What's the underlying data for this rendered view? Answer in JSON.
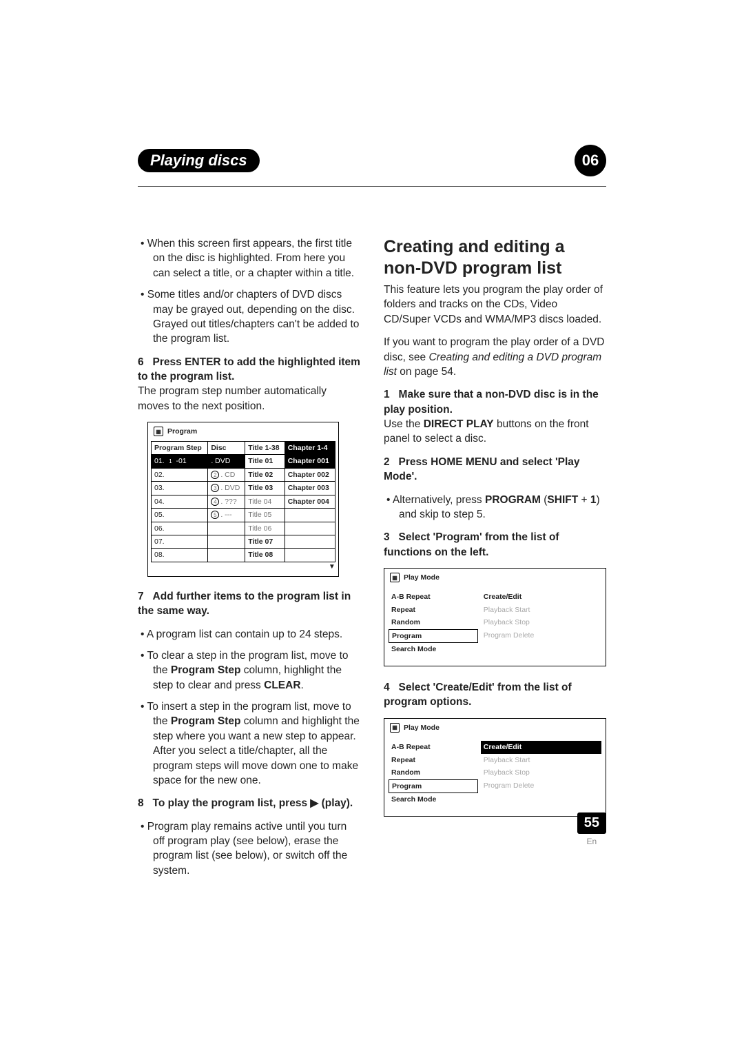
{
  "header": {
    "chapter_label": "Playing discs",
    "chapter_num": "06"
  },
  "left": {
    "intro_bullets": [
      "When this screen first appears, the first title on the disc is highlighted. From here you can select a title, or a chapter within a title.",
      "Some titles and/or chapters of DVD discs may be grayed out, depending on the disc. Grayed out titles/chapters can't be added to the program list."
    ],
    "step6_num": "6",
    "step6_head": "Press ENTER to add the highlighted item to the program list.",
    "step6_body": "The program step number automatically moves to the next position.",
    "prog_title": "Program",
    "prog_headers": {
      "step": "Program Step",
      "disc": "Disc",
      "title": "Title 1-38",
      "chapter": "Chapter 1-4"
    },
    "prog_rows": [
      {
        "step": "01.",
        "disc_num": "1",
        "disc_suffix": "-01",
        "disc": ". DVD",
        "title": "Title 01",
        "chapter": "Chapter 001",
        "sel": true,
        "bold_title": true,
        "bold_chap": true
      },
      {
        "step": "02.",
        "disc_num": "2",
        "disc": ". CD",
        "title": "Title 02",
        "chapter": "Chapter 002",
        "gray_disc": true,
        "bold_title": true,
        "bold_chap": true
      },
      {
        "step": "03.",
        "disc_num": "3",
        "disc": ". DVD",
        "title": "Title 03",
        "chapter": "Chapter 003",
        "gray_disc": true,
        "bold_title": true,
        "bold_chap": true
      },
      {
        "step": "04.",
        "disc_num": "4",
        "disc": ". ???",
        "title": "Title 04",
        "chapter": "Chapter 004",
        "gray_title": true,
        "gray_disc": true,
        "bold_chap": true
      },
      {
        "step": "05.",
        "disc_num": "5",
        "disc": ". ---",
        "title": "Title 05",
        "chapter": "",
        "gray_title": true,
        "gray_disc": true
      },
      {
        "step": "06.",
        "disc": "",
        "title": "Title 06",
        "chapter": "",
        "gray_title": true
      },
      {
        "step": "07.",
        "disc": "",
        "title": "Title 07",
        "chapter": "",
        "bold_title": true
      },
      {
        "step": "08.",
        "disc": "",
        "title": "Title 08",
        "chapter": "",
        "bold_title": true
      }
    ],
    "step7_num": "7",
    "step7_head": "Add further items to the program list in the same way.",
    "step7_b1": "A program list can contain up to 24 steps.",
    "step7_b2a": "To clear a step in the program list, move to the ",
    "step7_b2b": "Program Step",
    "step7_b2c": " column, highlight the step to clear and press ",
    "step7_b2d": "CLEAR",
    "step7_b2e": ".",
    "step7_b3a": "To insert a step in the program list, move to the ",
    "step7_b3b": "Program Step",
    "step7_b3c": " column and highlight the step where you want a new step to appear. After you select a title/chapter, all the program steps will move down one to make space for the new one.",
    "step8_num": "8",
    "step8_head": "To play the program list, press ▶ (play).",
    "step8_b1": "Program play remains active until you turn off program play (see below), erase the program list (see below), or switch off the system."
  },
  "right": {
    "h2": "Creating and editing a non-DVD program list",
    "p1": "This feature lets you program the play order of folders and tracks on the CDs, Video CD/Super VCDs and WMA/MP3 discs loaded.",
    "p2a": "If you want to program the play order of a DVD disc, see ",
    "p2b": "Creating and editing a DVD program list",
    "p2c": " on page 54.",
    "s1_num": "1",
    "s1_head": "Make sure that a non-DVD disc is in the play position.",
    "s1_a": "Use the ",
    "s1_b": "DIRECT PLAY",
    "s1_c": " buttons on the front panel to select a disc.",
    "s2_num": "2",
    "s2_head": "Press HOME MENU and select 'Play Mode'.",
    "s2_b1a": "Alternatively, press ",
    "s2_b1b": "PROGRAM",
    "s2_b1c": " (",
    "s2_b1d": "SHIFT",
    "s2_b1e": " + ",
    "s2_b1f": "1",
    "s2_b1g": ") and skip to step 5.",
    "s3_num": "3",
    "s3_head": "Select 'Program' from the list of functions on the left.",
    "pm_title": "Play Mode",
    "pm_left": [
      "A-B Repeat",
      "Repeat",
      "Random",
      "Program",
      "Search Mode"
    ],
    "pm_right": [
      {
        "label": "Create/Edit",
        "bold": true
      },
      {
        "label": "Playback Start",
        "faded": true
      },
      {
        "label": "Playback Stop",
        "faded": true
      },
      {
        "label": "Program Delete",
        "faded": true
      }
    ],
    "s4_num": "4",
    "s4_head": "Select 'Create/Edit' from the list of program options."
  },
  "footer": {
    "page": "55",
    "lang": "En"
  }
}
